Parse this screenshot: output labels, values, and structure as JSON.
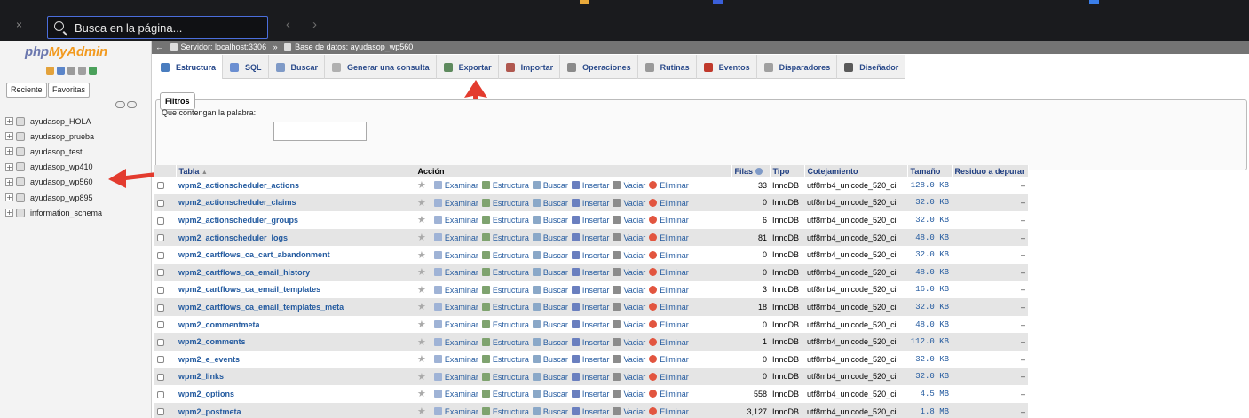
{
  "find": {
    "placeholder": "Busca en la página...",
    "close": "×",
    "prev": "‹",
    "next": "›"
  },
  "logo": {
    "php": "php",
    "myadmin": "MyAdmin"
  },
  "left": {
    "recent": "Reciente",
    "favorites": "Favoritas",
    "databases": [
      "ayudasop_HOLA",
      "ayudasop_prueba",
      "ayudasop_test",
      "ayudasop_wp410",
      "ayudasop_wp560",
      "ayudasop_wp895",
      "information_schema"
    ]
  },
  "breadcrumb": {
    "server": "Servidor: localhost:3306",
    "sep": "»",
    "db": "Base de datos: ayudasop_wp560"
  },
  "tabs": [
    {
      "label": "Estructura",
      "color": "#4a7dbf"
    },
    {
      "label": "SQL",
      "color": "#6a8ed1"
    },
    {
      "label": "Buscar",
      "color": "#7f9ac7"
    },
    {
      "label": "Generar una consulta",
      "color": "#b0b0b0"
    },
    {
      "label": "Exportar",
      "color": "#5e8a5e"
    },
    {
      "label": "Importar",
      "color": "#b0584f"
    },
    {
      "label": "Operaciones",
      "color": "#8a8a8a"
    },
    {
      "label": "Rutinas",
      "color": "#9a9a9a"
    },
    {
      "label": "Eventos",
      "color": "#c0392b"
    },
    {
      "label": "Disparadores",
      "color": "#a0a0a0"
    },
    {
      "label": "Diseñador",
      "color": "#5a5a5a"
    }
  ],
  "filters": {
    "legend": "Filtros",
    "label": "Que contengan la palabra:"
  },
  "table": {
    "headers": {
      "tabla": "Tabla",
      "sort": "▲",
      "accion": "Acción",
      "filas": "Filas",
      "tipo": "Tipo",
      "cotejamiento": "Cotejamiento",
      "tamano": "Tamaño",
      "residuo": "Residuo a depurar"
    },
    "actions": {
      "examinar": "Examinar",
      "estructura": "Estructura",
      "buscar": "Buscar",
      "insertar": "Insertar",
      "vaciar": "Vaciar",
      "eliminar": "Eliminar"
    },
    "rows": [
      {
        "name": "wpm2_actionscheduler_actions",
        "rows": "33",
        "type": "InnoDB",
        "collation": "utf8mb4_unicode_520_ci",
        "size": "128.0 KB",
        "overhead": "–"
      },
      {
        "name": "wpm2_actionscheduler_claims",
        "rows": "0",
        "type": "InnoDB",
        "collation": "utf8mb4_unicode_520_ci",
        "size": "32.0 KB",
        "overhead": "–"
      },
      {
        "name": "wpm2_actionscheduler_groups",
        "rows": "6",
        "type": "InnoDB",
        "collation": "utf8mb4_unicode_520_ci",
        "size": "32.0 KB",
        "overhead": "–"
      },
      {
        "name": "wpm2_actionscheduler_logs",
        "rows": "81",
        "type": "InnoDB",
        "collation": "utf8mb4_unicode_520_ci",
        "size": "48.0 KB",
        "overhead": "–"
      },
      {
        "name": "wpm2_cartflows_ca_cart_abandonment",
        "rows": "0",
        "type": "InnoDB",
        "collation": "utf8mb4_unicode_520_ci",
        "size": "32.0 KB",
        "overhead": "–"
      },
      {
        "name": "wpm2_cartflows_ca_email_history",
        "rows": "0",
        "type": "InnoDB",
        "collation": "utf8mb4_unicode_520_ci",
        "size": "48.0 KB",
        "overhead": "–"
      },
      {
        "name": "wpm2_cartflows_ca_email_templates",
        "rows": "3",
        "type": "InnoDB",
        "collation": "utf8mb4_unicode_520_ci",
        "size": "16.0 KB",
        "overhead": "–"
      },
      {
        "name": "wpm2_cartflows_ca_email_templates_meta",
        "rows": "18",
        "type": "InnoDB",
        "collation": "utf8mb4_unicode_520_ci",
        "size": "32.0 KB",
        "overhead": "–"
      },
      {
        "name": "wpm2_commentmeta",
        "rows": "0",
        "type": "InnoDB",
        "collation": "utf8mb4_unicode_520_ci",
        "size": "48.0 KB",
        "overhead": "–"
      },
      {
        "name": "wpm2_comments",
        "rows": "1",
        "type": "InnoDB",
        "collation": "utf8mb4_unicode_520_ci",
        "size": "112.0 KB",
        "overhead": "–"
      },
      {
        "name": "wpm2_e_events",
        "rows": "0",
        "type": "InnoDB",
        "collation": "utf8mb4_unicode_520_ci",
        "size": "32.0 KB",
        "overhead": "–"
      },
      {
        "name": "wpm2_links",
        "rows": "0",
        "type": "InnoDB",
        "collation": "utf8mb4_unicode_520_ci",
        "size": "32.0 KB",
        "overhead": "–"
      },
      {
        "name": "wpm2_options",
        "rows": "558",
        "type": "InnoDB",
        "collation": "utf8mb4_unicode_520_ci",
        "size": "4.5 MB",
        "overhead": "–"
      },
      {
        "name": "wpm2_postmeta",
        "rows": "3,127",
        "type": "InnoDB",
        "collation": "utf8mb4_unicode_520_ci",
        "size": "1.8 MB",
        "overhead": "–"
      }
    ]
  },
  "colors": {
    "accent_red": "#e33b2e",
    "link": "#235a9f",
    "topbar": "#1a1b1e"
  }
}
